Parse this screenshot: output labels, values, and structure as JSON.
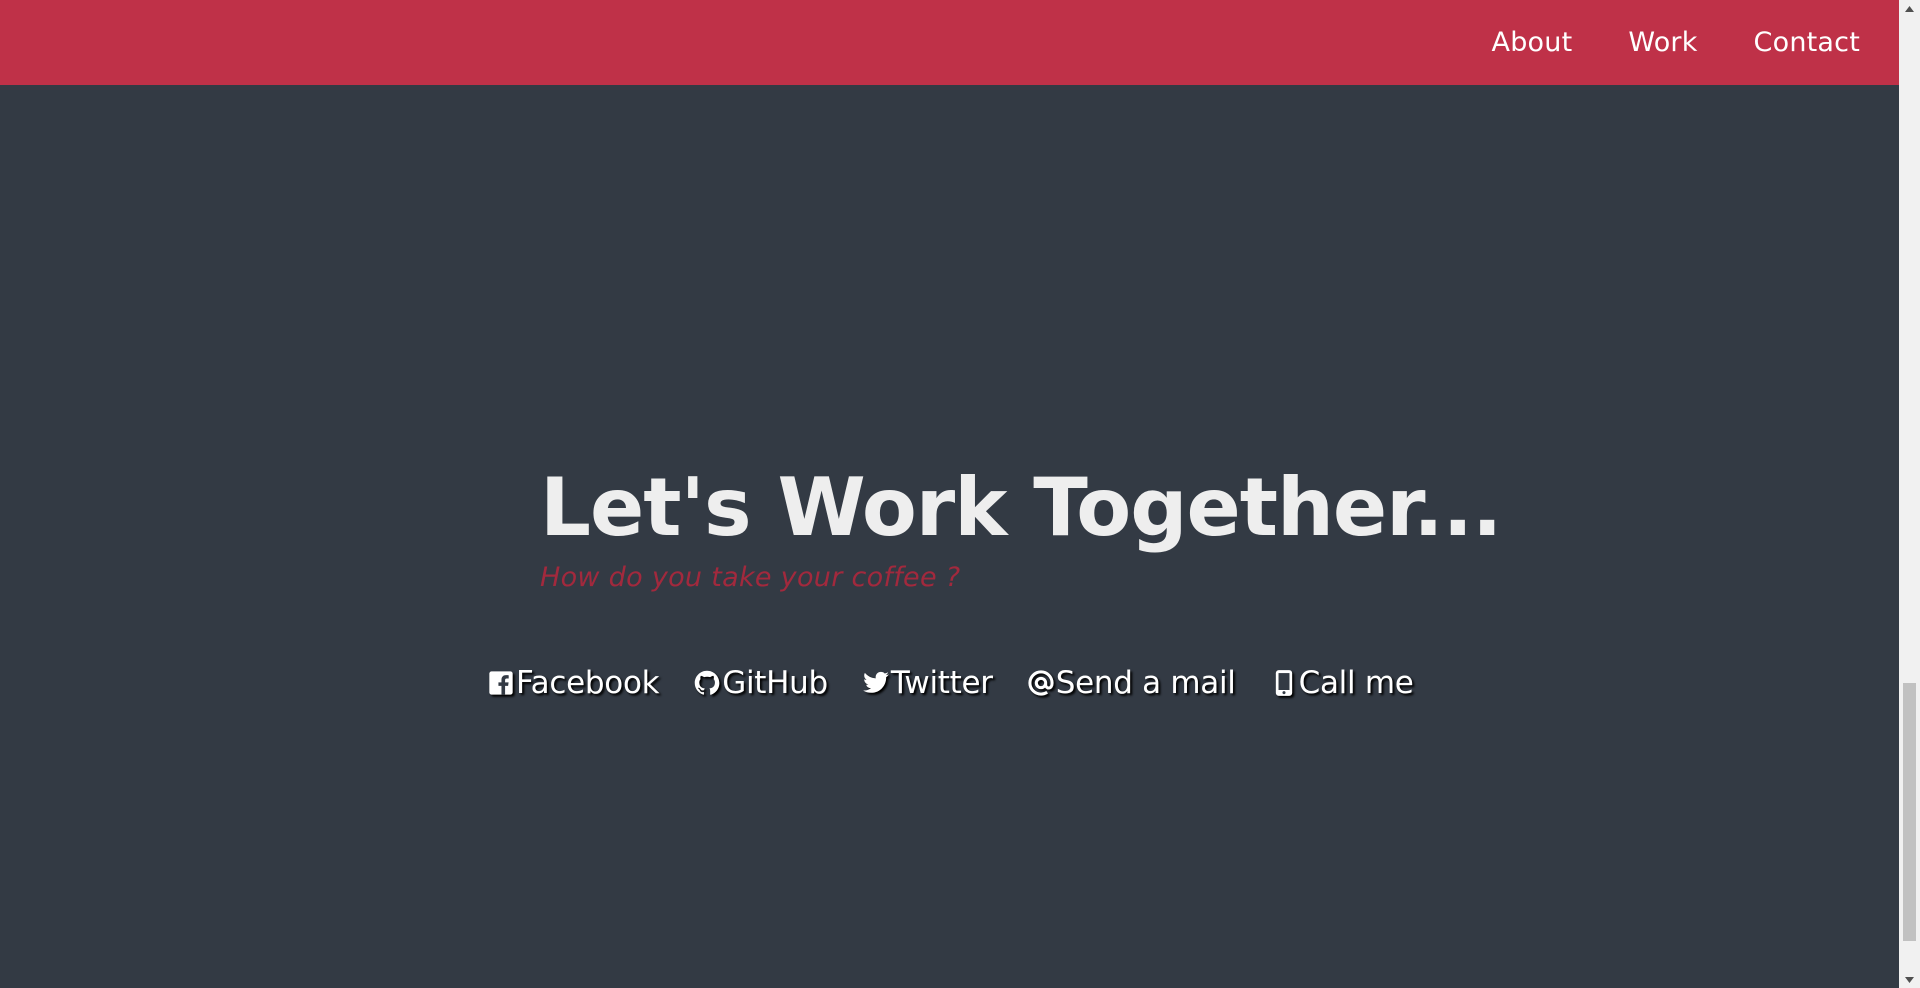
{
  "nav": {
    "links": [
      {
        "label": "About"
      },
      {
        "label": "Work"
      },
      {
        "label": "Contact"
      }
    ]
  },
  "hero": {
    "title": "Let's Work Together...",
    "subtitle": "How do you take your coffee ?"
  },
  "socials": [
    {
      "label": "Facebook",
      "icon": "facebook-icon"
    },
    {
      "label": "GitHub",
      "icon": "github-icon"
    },
    {
      "label": "Twitter",
      "icon": "twitter-icon"
    },
    {
      "label": "Send a mail",
      "icon": "at-sign-icon"
    },
    {
      "label": "Call me",
      "icon": "mobile-phone-icon"
    }
  ],
  "colors": {
    "navbar": "#bf3148",
    "background": "#333a44",
    "title": "#eeeeee",
    "subtitle": "#a2293d",
    "link": "#ffffff"
  },
  "scrollbar": {
    "position_fraction": 0.96
  }
}
